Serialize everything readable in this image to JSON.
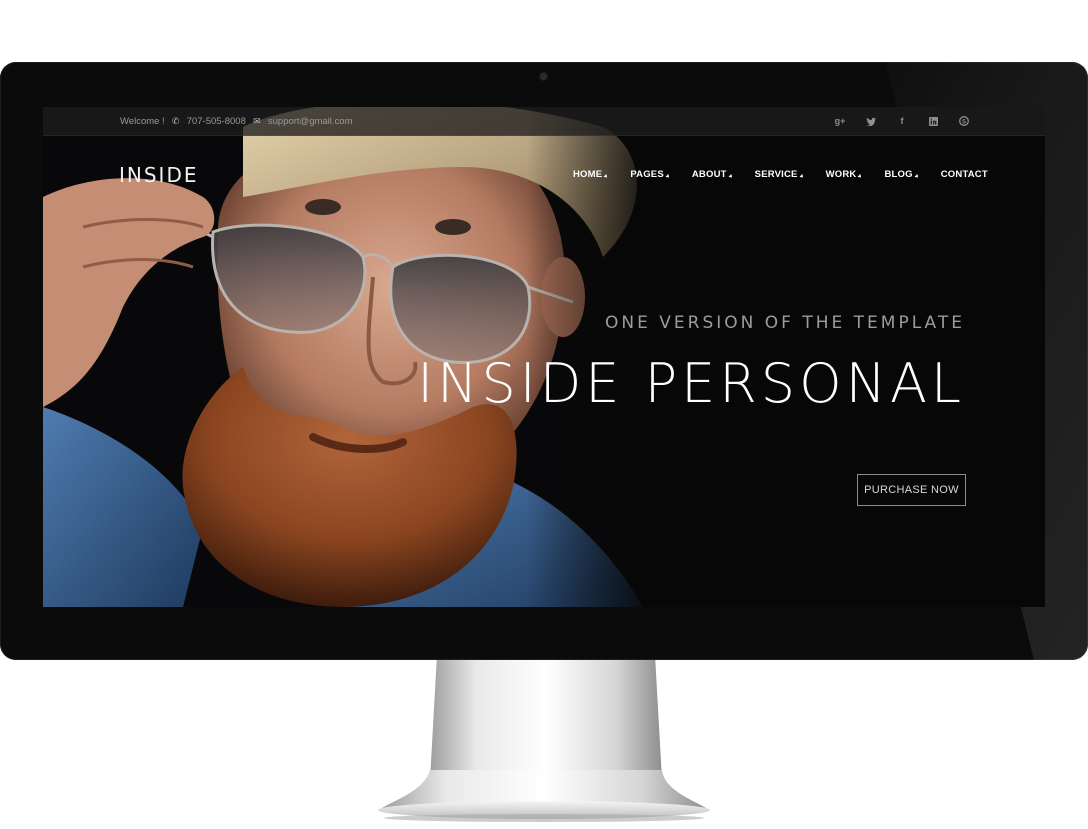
{
  "topbar": {
    "welcome": "Welcome !",
    "phone": "707-505-8008",
    "email": "support@gmail.com",
    "social_icons": [
      "google-plus-icon",
      "twitter-icon",
      "facebook-icon",
      "linkedin-icon",
      "skype-icon"
    ]
  },
  "header": {
    "logo": "INSIDE",
    "nav": [
      {
        "label": "HOME",
        "has_dropdown": true
      },
      {
        "label": "PAGES",
        "has_dropdown": true
      },
      {
        "label": "ABOUT",
        "has_dropdown": true
      },
      {
        "label": "SERVICE",
        "has_dropdown": true
      },
      {
        "label": "WORK",
        "has_dropdown": true
      },
      {
        "label": "BLOG",
        "has_dropdown": true
      },
      {
        "label": "CONTACT",
        "has_dropdown": false
      }
    ]
  },
  "hero": {
    "subtitle": "ONE VERSION OF THE TEMPLATE",
    "title": "INSIDE PERSONAL",
    "cta_label": "PURCHASE NOW"
  },
  "colors": {
    "screen_bg": "#070708",
    "bezel": "#0b0b0b",
    "text_primary": "#ffffff",
    "text_muted": "#9c9c9c"
  }
}
